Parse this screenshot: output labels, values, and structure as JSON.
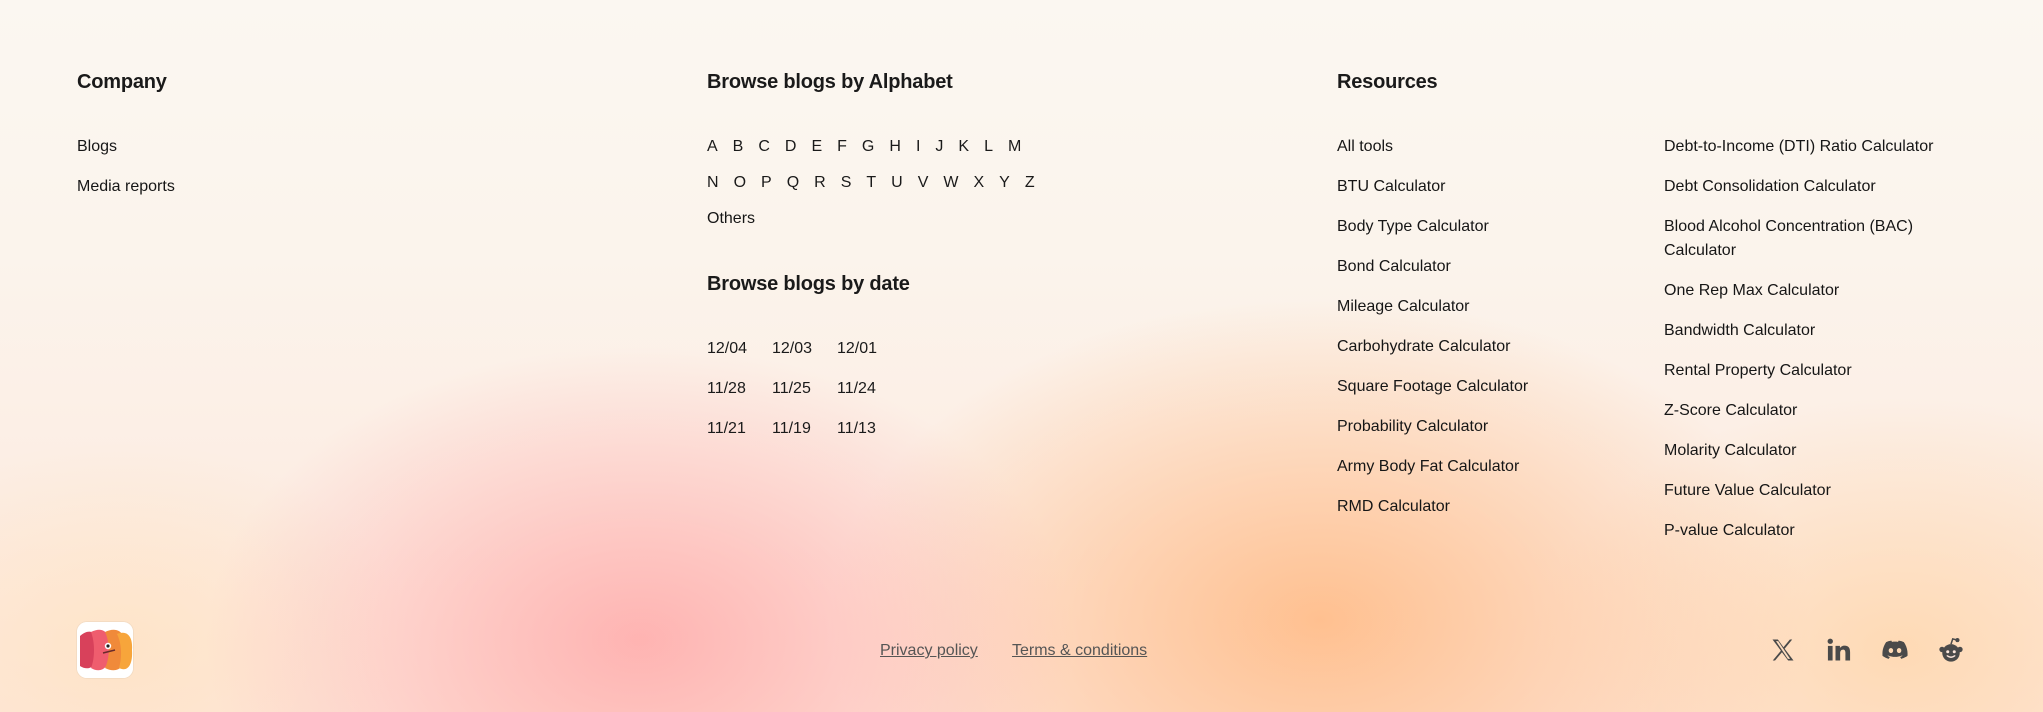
{
  "company": {
    "heading": "Company",
    "links": [
      "Blogs",
      "Media reports"
    ]
  },
  "alphabet": {
    "heading": "Browse blogs by Alphabet",
    "row1": [
      "A",
      "B",
      "C",
      "D",
      "E",
      "F",
      "G",
      "H",
      "I",
      "J",
      "K",
      "L",
      "M"
    ],
    "row2": [
      "N",
      "O",
      "P",
      "Q",
      "R",
      "S",
      "T",
      "U",
      "V",
      "W",
      "X",
      "Y",
      "Z"
    ],
    "others": "Others"
  },
  "dates": {
    "heading": "Browse blogs by date",
    "items": [
      "12/04",
      "12/03",
      "12/01",
      "11/28",
      "11/25",
      "11/24",
      "11/21",
      "11/19",
      "11/13"
    ]
  },
  "resources": {
    "heading": "Resources",
    "col1": [
      "All tools",
      "BTU Calculator",
      "Body Type Calculator",
      "Bond Calculator",
      "Mileage Calculator",
      "Carbohydrate Calculator",
      "Square Footage Calculator",
      "Probability Calculator",
      "Army Body Fat Calculator",
      "RMD Calculator"
    ],
    "col2": [
      "Debt-to-Income (DTI) Ratio Calculator",
      "Debt Consolidation Calculator",
      "Blood Alcohol Concentration (BAC)",
      "Calculator",
      "One Rep Max Calculator",
      "Bandwidth Calculator",
      "Rental Property Calculator",
      "Z-Score Calculator",
      "Molarity Calculator",
      "Future Value Calculator",
      "P-value Calculator"
    ]
  },
  "footer": {
    "privacy": "Privacy policy",
    "terms": "Terms & conditions",
    "logo_icon": "brand-logo-icon",
    "social_icons": [
      "x-twitter-icon",
      "linkedin-icon",
      "discord-icon",
      "reddit-icon"
    ]
  },
  "colors": {
    "text": "#161616",
    "muted": "#555555",
    "social": "#4a4a4a"
  }
}
